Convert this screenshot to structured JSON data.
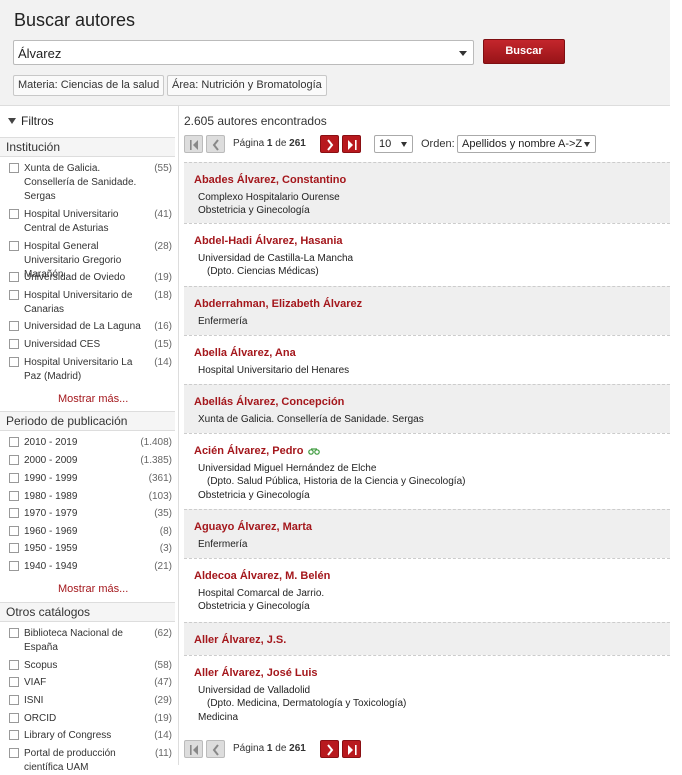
{
  "header": {
    "title": "Buscar autores",
    "query": "Álvarez",
    "search_button": "Buscar",
    "chips": [
      "Materia: Ciencias de la salud",
      "Área: Nutrición y Bromatología"
    ]
  },
  "sidebar": {
    "title": "Filtros",
    "institucion": {
      "title": "Institución",
      "items": [
        {
          "label": "Xunta de Galicia. Consellería de Sanidade. Sergas",
          "count": "(55)"
        },
        {
          "label": "Hospital Universitario Central de Asturias",
          "count": "(41)"
        },
        {
          "label": "Hospital General Universitario Gregorio Marañón",
          "count": "(28)"
        },
        {
          "label": "Universidad de Oviedo",
          "count": "(19)"
        },
        {
          "label": "Hospital Universitario de Canarias",
          "count": "(18)"
        },
        {
          "label": "Universidad de La Laguna",
          "count": "(16)"
        },
        {
          "label": "Universidad CES",
          "count": "(15)"
        },
        {
          "label": "Hospital Universitario La Paz (Madrid)",
          "count": "(14)"
        }
      ],
      "more": "Mostrar más..."
    },
    "periodo": {
      "title": "Periodo de publicación",
      "items": [
        {
          "label": "2010 - 2019",
          "count": "(1.408)"
        },
        {
          "label": "2000 - 2009",
          "count": "(1.385)"
        },
        {
          "label": "1990 - 1999",
          "count": "(361)"
        },
        {
          "label": "1980 - 1989",
          "count": "(103)"
        },
        {
          "label": "1970 - 1979",
          "count": "(35)"
        },
        {
          "label": "1960 - 1969",
          "count": "(8)"
        },
        {
          "label": "1950 - 1959",
          "count": "(3)"
        },
        {
          "label": "1940 - 1949",
          "count": "(21)"
        }
      ],
      "more": "Mostrar más..."
    },
    "otros": {
      "title": "Otros catálogos",
      "items": [
        {
          "label": "Biblioteca Nacional de España",
          "count": "(62)"
        },
        {
          "label": "Scopus",
          "count": "(58)"
        },
        {
          "label": "VIAF",
          "count": "(47)"
        },
        {
          "label": "ISNI",
          "count": "(29)"
        },
        {
          "label": "ORCID",
          "count": "(19)"
        },
        {
          "label": "Library of Congress",
          "count": "(14)"
        },
        {
          "label": "Portal de producción científica UAM",
          "count": "(11)"
        }
      ]
    }
  },
  "results": {
    "count_text": "2.605 autores encontrados",
    "pager": {
      "prefix": "Página",
      "page": "1",
      "of": "de",
      "total": "261"
    },
    "per_page": "10",
    "order_label": "Orden:",
    "order_value": "Apellidos y nombre A->Z",
    "items": [
      {
        "name": "Abades Álvarez, Constantino",
        "lines": [
          "Complexo Hospitalario Ourense"
        ],
        "sub": "",
        "extra": "Obstetricia y Ginecología"
      },
      {
        "name": "Abdel-Hadi Álvarez, Hasania",
        "lines": [
          "Universidad de Castilla-La Mancha"
        ],
        "sub": "(Dpto. Ciencias Médicas)",
        "extra": ""
      },
      {
        "name": "Abderrahman, Elizabeth Álvarez",
        "lines": [
          "Enfermería"
        ],
        "sub": "",
        "extra": ""
      },
      {
        "name": "Abella Álvarez, Ana",
        "lines": [
          "Hospital Universitario del Henares"
        ],
        "sub": "",
        "extra": ""
      },
      {
        "name": "Abellás Álvarez, Concepción",
        "lines": [
          "Xunta de Galicia. Consellería de Sanidade. Sergas"
        ],
        "sub": "",
        "extra": ""
      },
      {
        "name": "Acién Álvarez, Pedro",
        "lines": [
          "Universidad Miguel Hernández de Elche"
        ],
        "sub": "(Dpto. Salud Pública, Historia de la Ciencia y Ginecología)",
        "extra": "Obstetricia y Ginecología"
      },
      {
        "name": "Aguayo Álvarez, Marta",
        "lines": [
          "Enfermería"
        ],
        "sub": "",
        "extra": ""
      },
      {
        "name": "Aldecoa Álvarez, M. Belén",
        "lines": [
          "Hospital Comarcal de Jarrio."
        ],
        "sub": "",
        "extra": "Obstetricia y Ginecología"
      },
      {
        "name": "Aller Álvarez, J.S.",
        "lines": [],
        "sub": "",
        "extra": ""
      },
      {
        "name": "Aller Álvarez, José Luis",
        "lines": [
          "Universidad de Valladolid"
        ],
        "sub": "(Dpto. Medicina, Dermatología y Toxicología)",
        "extra": "Medicina"
      }
    ]
  },
  "colors": {
    "accent": "#a4171c"
  }
}
